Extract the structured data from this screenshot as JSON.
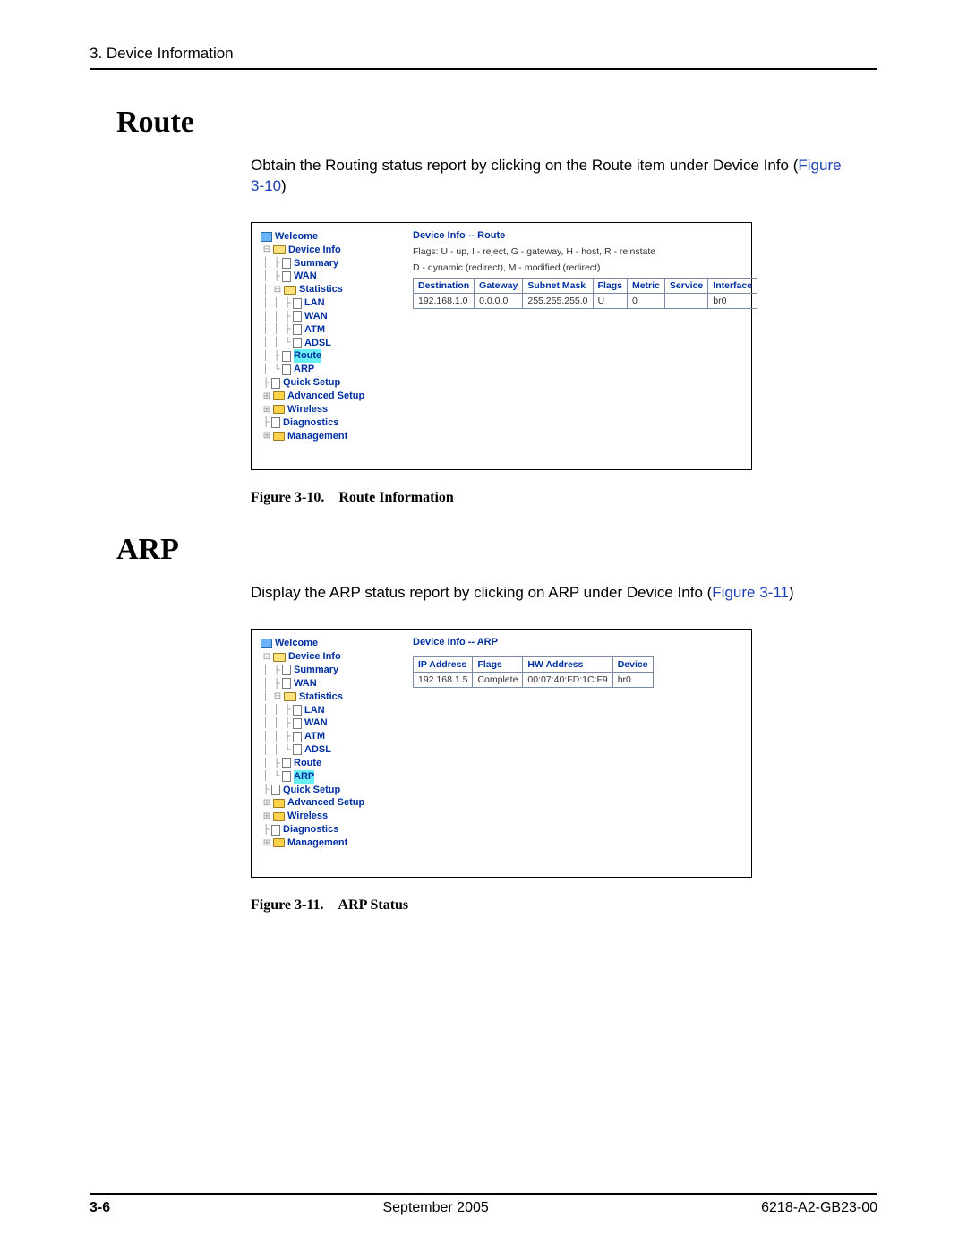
{
  "header": {
    "chapter": "3. Device Information"
  },
  "sections": {
    "route": {
      "heading": "Route",
      "para_pre": "Obtain the Routing status report by clicking on the Route item under Device Info (",
      "para_link": "Figure 3-10",
      "para_post": ")",
      "fig": {
        "pane_title": "Device Info -- Route",
        "flags_line1": "Flags: U - up, ! - reject, G - gateway, H - host, R - reinstate",
        "flags_line2": "D - dynamic (redirect), M - modified (redirect).",
        "table": {
          "headers": [
            "Destination",
            "Gateway",
            "Subnet Mask",
            "Flags",
            "Metric",
            "Service",
            "Interface"
          ],
          "row": [
            "192.168.1.0",
            "0.0.0.0",
            "255.255.255.0",
            "U",
            "0",
            "",
            "br0"
          ]
        },
        "nav": {
          "welcome": "Welcome",
          "device_info": "Device Info",
          "summary": "Summary",
          "wan": "WAN",
          "statistics": "Statistics",
          "lan": "LAN",
          "wan2": "WAN",
          "atm": "ATM",
          "adsl": "ADSL",
          "route": "Route",
          "arp": "ARP",
          "quick_setup": "Quick Setup",
          "advanced_setup": "Advanced Setup",
          "wireless": "Wireless",
          "diagnostics": "Diagnostics",
          "management": "Management"
        }
      },
      "caption": "Figure 3-10. Route Information"
    },
    "arp": {
      "heading": "ARP",
      "para_pre": "Display the ARP status report by clicking on ARP under Device Info (",
      "para_link": "Figure 3-11",
      "para_post": ")",
      "fig": {
        "pane_title": "Device Info -- ARP",
        "table": {
          "headers": [
            "IP Address",
            "Flags",
            "HW Address",
            "Device"
          ],
          "row": [
            "192.168.1.5",
            "Complete",
            "00:07:40:FD:1C:F9",
            "br0"
          ]
        },
        "nav": {
          "welcome": "Welcome",
          "device_info": "Device Info",
          "summary": "Summary",
          "wan": "WAN",
          "statistics": "Statistics",
          "lan": "LAN",
          "wan2": "WAN",
          "atm": "ATM",
          "adsl": "ADSL",
          "route": "Route",
          "arp": "ARP",
          "quick_setup": "Quick Setup",
          "advanced_setup": "Advanced Setup",
          "wireless": "Wireless",
          "diagnostics": "Diagnostics",
          "management": "Management"
        }
      },
      "caption": "Figure 3-11. ARP Status"
    }
  },
  "footer": {
    "page": "3-6",
    "date": "September 2005",
    "doc": "6218-A2-GB23-00"
  }
}
